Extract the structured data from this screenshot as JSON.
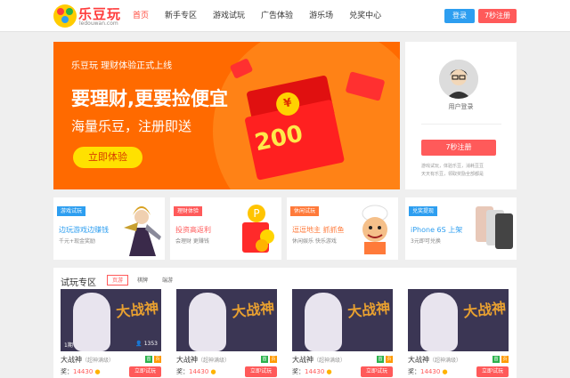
{
  "header": {
    "logo_text": "乐豆玩",
    "logo_domain": "ledouwan.com",
    "nav": [
      "首页",
      "新手专区",
      "游戏试玩",
      "广告体验",
      "游乐场",
      "兑奖中心"
    ],
    "login_label": "登录",
    "register_label": "7秒注册",
    "accent_color": "#ff4b3e"
  },
  "banner": {
    "title": "乐豆玩  理财体验正式上线",
    "headline": "要理财,更要捡便宜",
    "subline": "海量乐豆，注册即送",
    "cta": "立即体验",
    "amount": "200",
    "coin_symbol": "¥"
  },
  "user_panel": {
    "login_text": "用户登录",
    "register_label": "7秒注册",
    "hint1": "游戏试玩，体验乐豆，消耗豆豆",
    "hint2": "天天有乐豆，领取奖励全部都是"
  },
  "promos": [
    {
      "tag": "游戏试玩",
      "title": "边玩游戏边赚钱",
      "desc": "千元+现金奖励",
      "tag_color": "#2d9ef0",
      "title_color": "#2d9ef0"
    },
    {
      "tag": "理财体验",
      "title": "投资高返利",
      "desc": "会理财  更赚钱",
      "tag_color": "#ff5a5a",
      "title_color": "#ff5a5a"
    },
    {
      "tag": "休闲试玩",
      "title": "逗逗地主  抓抓鱼",
      "desc": "休闲娱乐  快乐游戏",
      "tag_color": "#ff7a3a",
      "title_color": "#ff7a3a"
    },
    {
      "tag": "兑奖提现",
      "title": "iPhone 6S 上架",
      "desc": "3元即可兑换",
      "tag_color": "#2d9ef0",
      "title_color": "#2d9ef0"
    }
  ],
  "trial": {
    "title": "试玩专区",
    "tabs": [
      "页游",
      "棋牌",
      "端游"
    ],
    "games": [
      {
        "name": "大战神",
        "tag": "（超神满级）",
        "reward_label": "奖：",
        "amount": "14430",
        "button": "立即试玩",
        "rank": "1期",
        "count": "1353",
        "art_text": "大战神"
      },
      {
        "name": "大战神",
        "tag": "（超神满级）",
        "reward_label": "奖：",
        "amount": "14430",
        "button": "立即试玩",
        "rank": "",
        "count": "",
        "art_text": "大战神"
      },
      {
        "name": "大战神",
        "tag": "（超神满级）",
        "reward_label": "奖：",
        "amount": "14430",
        "button": "立即试玩",
        "rank": "",
        "count": "",
        "art_text": "大战神"
      },
      {
        "name": "大战神",
        "tag": "（超神满级）",
        "reward_label": "奖：",
        "amount": "14430",
        "button": "立即试玩",
        "rank": "",
        "count": "",
        "art_text": "大战神"
      }
    ],
    "badges": [
      "首",
      "页"
    ]
  }
}
